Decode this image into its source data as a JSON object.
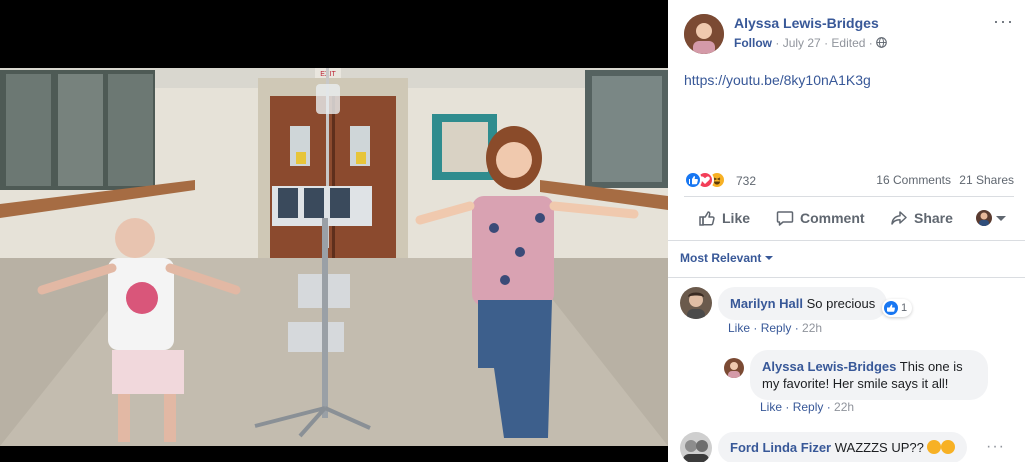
{
  "post": {
    "author": "Alyssa Lewis-Bridges",
    "follow": "Follow",
    "separator": "·",
    "date": "July 27",
    "edited": "Edited",
    "more": "···",
    "link": "https://youtu.be/8ky10nA1K3g"
  },
  "stats": {
    "reactions": "732",
    "comments": "16 Comments",
    "shares": "21 Shares"
  },
  "actions": {
    "like": "Like",
    "comment": "Comment",
    "share": "Share"
  },
  "sort": {
    "label": "Most Relevant"
  },
  "comments": [
    {
      "name": "Marilyn Hall",
      "text": "So precious",
      "like_count": "1",
      "like": "Like",
      "reply": "Reply",
      "time": "22h"
    },
    {
      "name": "Alyssa Lewis-Bridges",
      "text": "This one is my favorite! Her smile says it all!",
      "like": "Like",
      "reply": "Reply",
      "time": "22h"
    },
    {
      "name": "Ford Linda Fizer",
      "text": "WAZZZS UP??",
      "more": "···"
    }
  ],
  "photo": {
    "exit_sign": "EXIT"
  },
  "colors": {
    "link": "#385898",
    "like_blue": "#1877f2",
    "love_red": "#f33e58",
    "haha_yellow": "#f7b125"
  },
  "icons": [
    "globe-icon",
    "like-reaction-icon",
    "love-reaction-icon",
    "haha-reaction-icon",
    "thumbs-up-icon",
    "comment-icon",
    "share-icon",
    "chevron-down-icon",
    "more-icon"
  ]
}
